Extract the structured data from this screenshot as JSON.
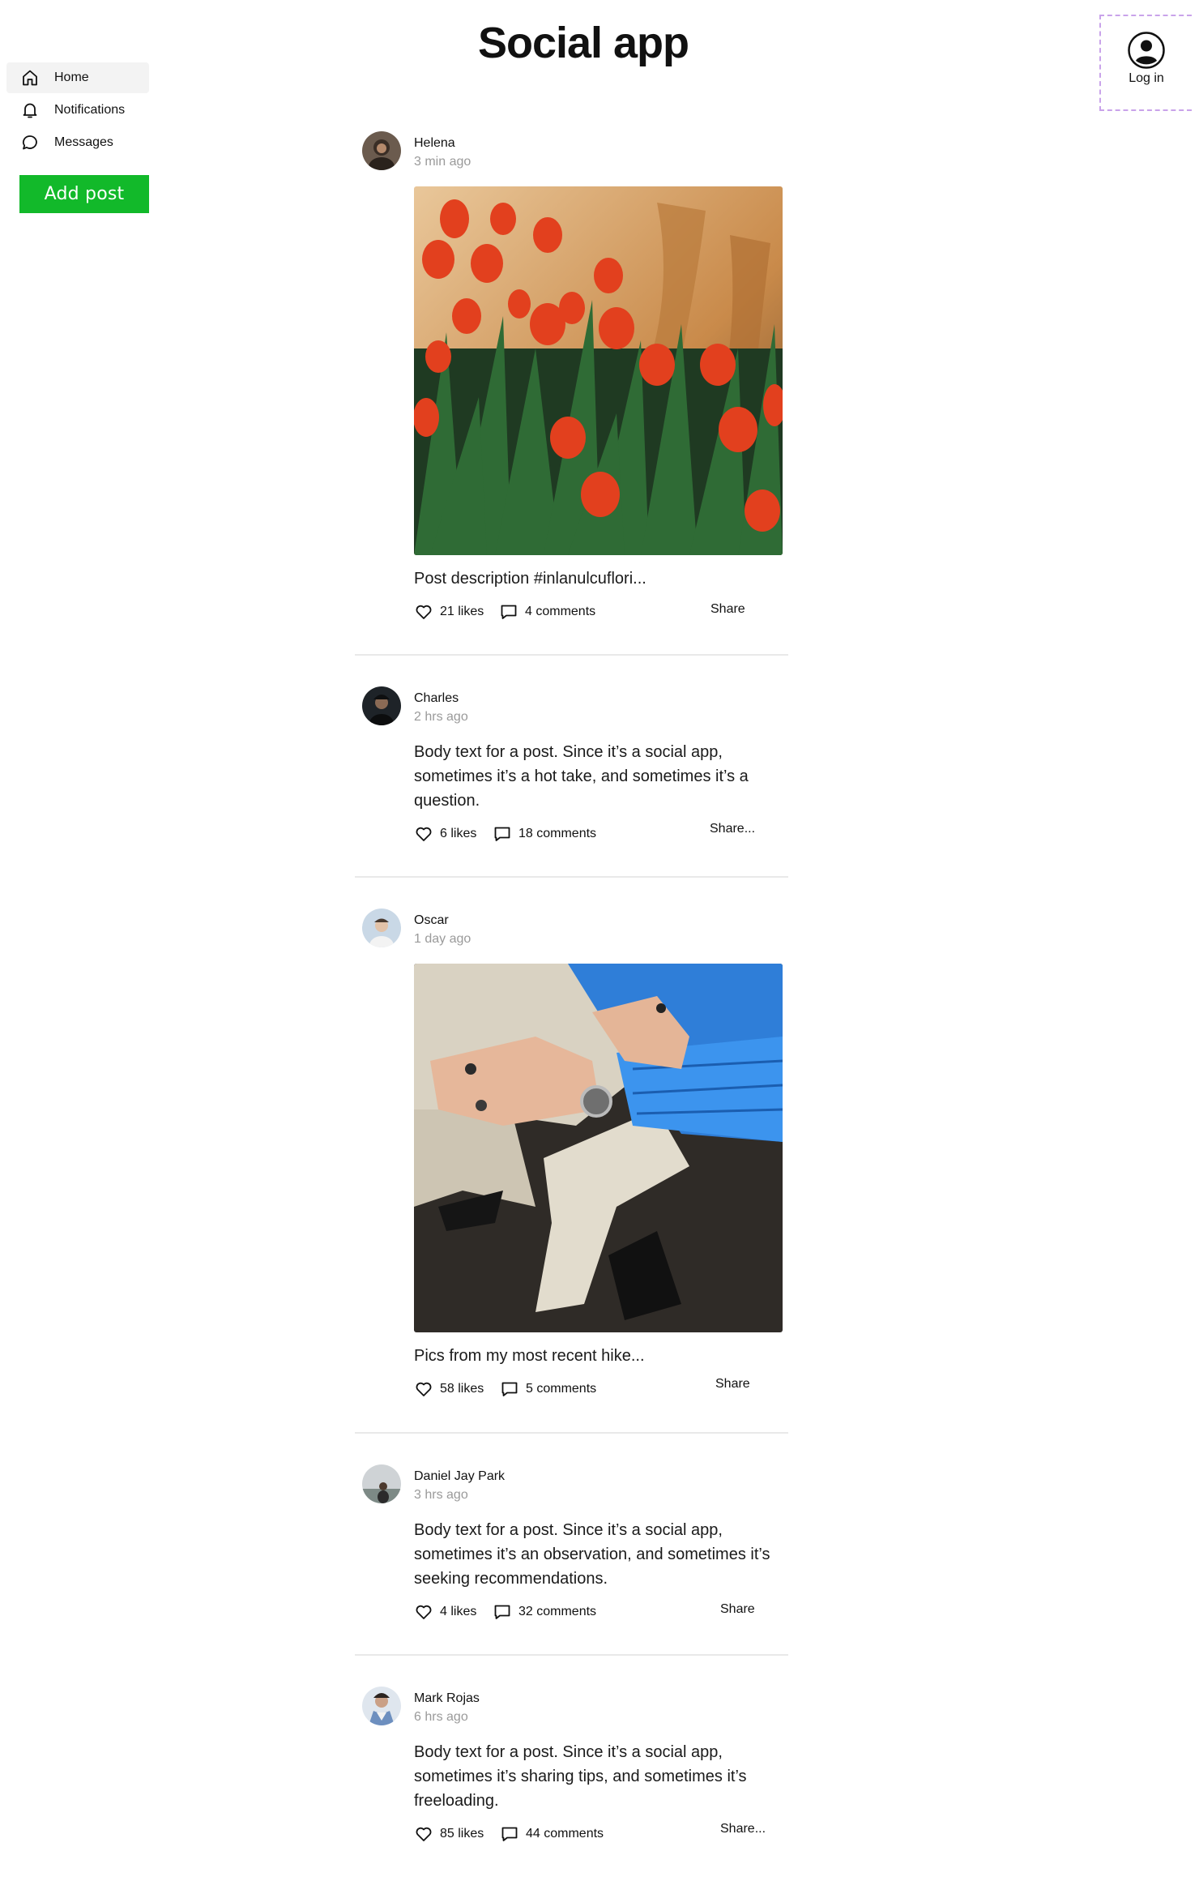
{
  "app": {
    "title": "Social app"
  },
  "sidebar": {
    "items": [
      {
        "label": "Home",
        "icon": "home-icon"
      },
      {
        "label": "Notifications",
        "icon": "bell-icon"
      },
      {
        "label": "Messages",
        "icon": "message-icon"
      }
    ],
    "add_post_label": "Add post",
    "add_post_color": "#12b92a"
  },
  "login": {
    "label": "Log in",
    "icon": "user-circle-icon"
  },
  "posts": [
    {
      "author": "Helena",
      "time": "3 min ago",
      "image": "red tulips photo",
      "text": "Post description #inlanulcuflori...",
      "likes": "21 likes",
      "comments": "4 comments",
      "share": "Share"
    },
    {
      "author": "Charles",
      "time": "2 hrs ago",
      "text": "Body text for a post. Since it’s a social app, sometimes it’s a hot take, and sometimes it’s a question.",
      "likes": "6 likes",
      "comments": "18 comments",
      "share": "Share..."
    },
    {
      "author": "Oscar",
      "time": "1 day ago",
      "image": "hands with rings and blue jacket photo",
      "text": "Pics from my most recent hike...",
      "likes": "58 likes",
      "comments": "5 comments",
      "share": "Share"
    },
    {
      "author": "Daniel Jay Park",
      "time": "3 hrs ago",
      "text": "Body text for a post. Since it’s a social app, sometimes it’s an observation, and sometimes it’s seeking recommendations.",
      "likes": "4 likes",
      "comments": "32 comments",
      "share": "Share"
    },
    {
      "author": "Mark Rojas",
      "time": "6 hrs ago",
      "text": "Body text for a post. Since it’s a social app, sometimes it’s sharing tips, and sometimes it’s freeloading.",
      "likes": "85 likes",
      "comments": "44 comments",
      "share": "Share..."
    }
  ]
}
